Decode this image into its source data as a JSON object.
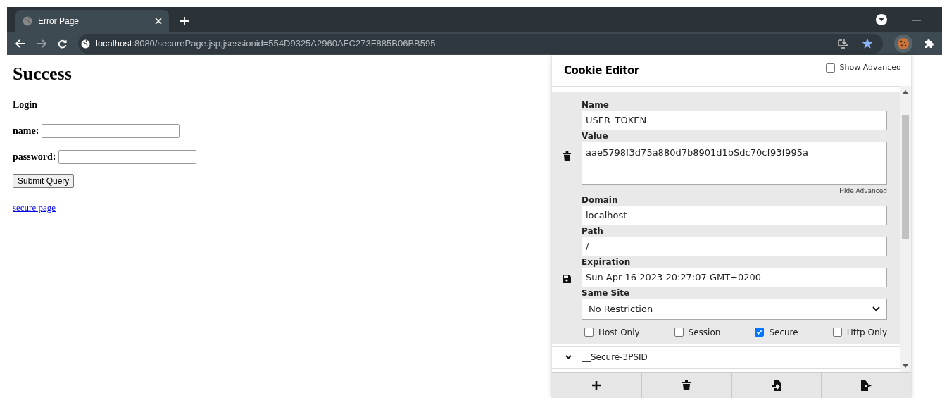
{
  "browser": {
    "tabs": [
      {
        "title": "Error Page",
        "selected": true
      }
    ],
    "url_host": "localhost",
    "url_rest": ":8080/securePage.jsp;jsessionid=554D9325A2960AFC273F885B06BB595"
  },
  "page": {
    "heading": "Success",
    "subheading": "Login",
    "fields": [
      {
        "label": "name:"
      },
      {
        "label": "password:"
      }
    ],
    "submit": "Submit Query",
    "link": "secure page"
  },
  "cookie_editor": {
    "title": "Cookie Editor",
    "show_advanced": {
      "label": "Show Advanced",
      "checked": false
    },
    "cookies": [
      {
        "name": "USER_TOKEN",
        "expanded": true,
        "labels": {
          "name": "Name",
          "value": "Value",
          "domain": "Domain",
          "path": "Path",
          "expiration": "Expiration",
          "same_site": "Same Site"
        },
        "value": "aae5798f3d75a880d7b8901d1bSdc70cf93f995a",
        "hide_advanced": "Hide Advanced",
        "domain": "localhost",
        "path": "/",
        "expiration": "Sun Apr 16 2023 20:27:07 GMT+0200",
        "same_site": "No Restriction",
        "flags": [
          {
            "label": "Host Only",
            "checked": false
          },
          {
            "label": "Session",
            "checked": false
          },
          {
            "label": "Secure",
            "checked": true
          },
          {
            "label": "Http Only",
            "checked": false
          }
        ]
      },
      {
        "name": "__Secure-3PSID",
        "expanded": false
      }
    ],
    "footer": [
      {
        "kind": "add"
      },
      {
        "kind": "delete"
      },
      {
        "kind": "import"
      },
      {
        "kind": "export"
      }
    ]
  }
}
